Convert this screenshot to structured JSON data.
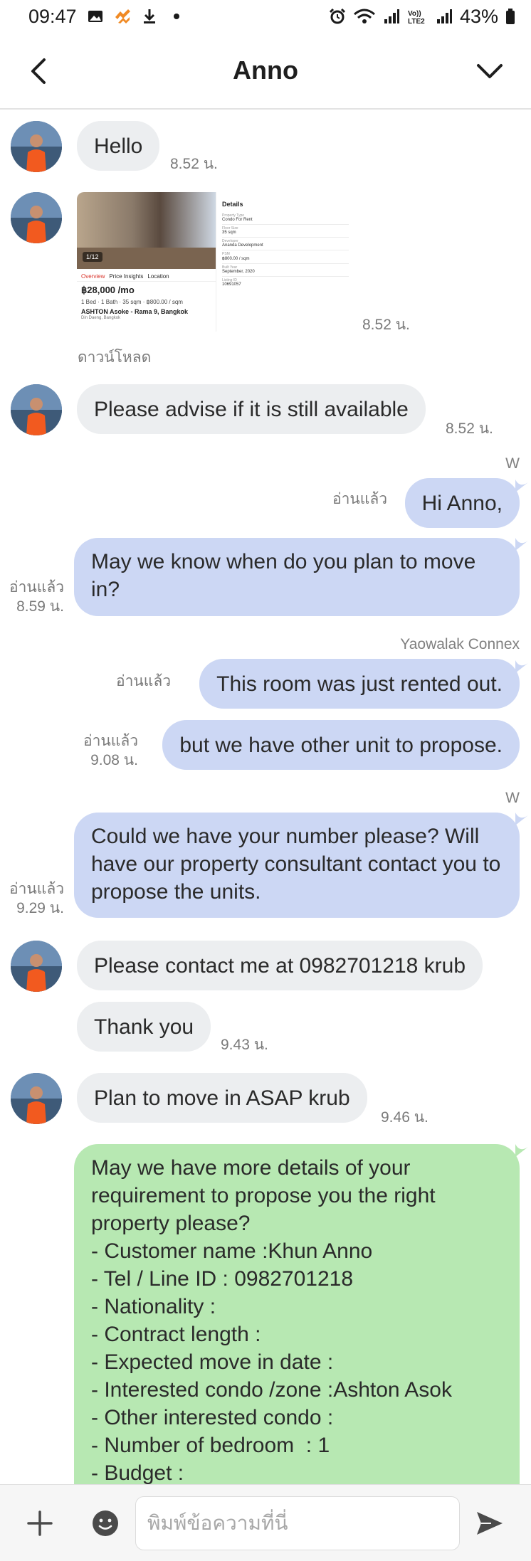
{
  "status_bar": {
    "time": "09:47",
    "battery": "43%",
    "icons": [
      "gallery-icon",
      "app-icon",
      "download-icon",
      "dot-icon",
      "alarm-icon",
      "wifi-icon",
      "signal-icon",
      "volte-icon",
      "signal-icon",
      "battery-icon"
    ]
  },
  "header": {
    "title": "Anno",
    "back_icon": "chevron-left-icon",
    "menu_icon": "chevron-down-icon"
  },
  "messages": {
    "m1": {
      "text": "Hello",
      "time": "8.52 น."
    },
    "m2": {
      "time": "8.52 น.",
      "download_label": "ดาวน์โหลด",
      "card": {
        "photo_tag": "1/12",
        "tabs": [
          "Overview",
          "Price Insights",
          "Location"
        ],
        "price": "฿28,000 /mo",
        "specs": "1 Bed · 1 Bath · 35 sqm · ฿800.00 / sqm",
        "name": "ASHTON Asoke - Rama 9, Bangkok",
        "address": "Din Daeng, Bangkok",
        "details_title": "Details",
        "details": [
          {
            "label": "Property Type",
            "value": "Condo For Rent"
          },
          {
            "label": "Floor Size",
            "value": "35 sqm"
          },
          {
            "label": "Developer",
            "value": "Ananda Development"
          },
          {
            "label": "PSM",
            "value": "฿800.00 / sqm"
          },
          {
            "label": "Built Year",
            "value": "September, 2020"
          },
          {
            "label": "Listing ID",
            "value": "10691057"
          }
        ]
      }
    },
    "m3": {
      "text": "Please advise if it is still available",
      "time": "8.52 น."
    },
    "m4": {
      "sender": "W",
      "text": "Hi Anno,",
      "read": "อ่านแล้ว"
    },
    "m5": {
      "text": "May we know when do you plan to move in?",
      "read": "อ่านแล้ว",
      "time": "8.59 น."
    },
    "m6": {
      "sender": "Yaowalak Connex",
      "text": "This room was just rented out.",
      "read": "อ่านแล้ว"
    },
    "m7": {
      "text": "but we have other unit to propose.",
      "read": "อ่านแล้ว",
      "time": "9.08 น."
    },
    "m8": {
      "sender": "W",
      "text": "Could we have your number please? Will have our property consultant contact you to propose the units.",
      "read": "อ่านแล้ว",
      "time": "9.29 น."
    },
    "m9": {
      "text": "Please contact me at 0982701218 krub"
    },
    "m10": {
      "text": "Thank you",
      "time": "9.43 น."
    },
    "m11": {
      "text": "Plan to move in ASAP krub",
      "time": "9.46 น."
    },
    "m12": {
      "lines": [
        "May we have more details of your",
        "requirement to propose you the right",
        "property please?",
        "- Customer name :Khun Anno",
        "- Tel / Line ID : 0982701218",
        "- Nationality :",
        "- Contract length :",
        "- Expected move in date :",
        "- Interested condo /zone :Ashton Asok",
        "- Other interested condo :",
        "- Number of bedroom  : 1",
        "- Budget :"
      ]
    }
  },
  "input_bar": {
    "placeholder": "พิมพ์ข้อความที่นี่",
    "plus_icon": "plus-icon",
    "emoji_icon": "emoji-icon",
    "send_icon": "send-icon"
  },
  "colors": {
    "incoming_bubble": "#eceef0",
    "outgoing_bubble": "#ccd7f4",
    "template_bubble": "#b7e8b2",
    "accent": "#5566aa"
  }
}
